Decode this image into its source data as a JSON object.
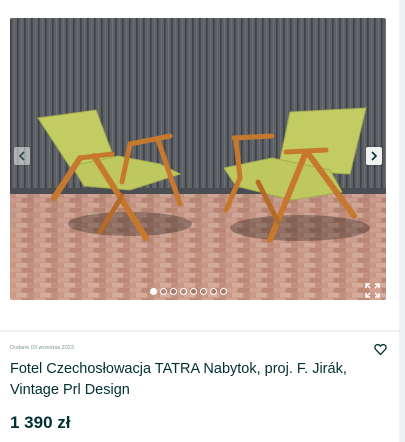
{
  "gallery": {
    "photo_alt": "Two armchairs on a brick patio",
    "prev_icon": "chevron-left-icon",
    "next_icon": "chevron-right-icon",
    "expand_icon": "expand-icon",
    "image_count": 8,
    "current_image": 1
  },
  "listing": {
    "date": "Dodane 03 września 2023",
    "title": "Fotel Czechosłowacja TATRA Nabytok, proj. F. Jirák, Vintage Prl Design",
    "price": "1 390 zł",
    "favorite_icon": "heart-icon"
  },
  "colors": {
    "text": "#002f34",
    "muted": "#7f9799",
    "background": "#eef1f2",
    "upholstery": "#c3cc63",
    "wood": "#c7782f"
  }
}
